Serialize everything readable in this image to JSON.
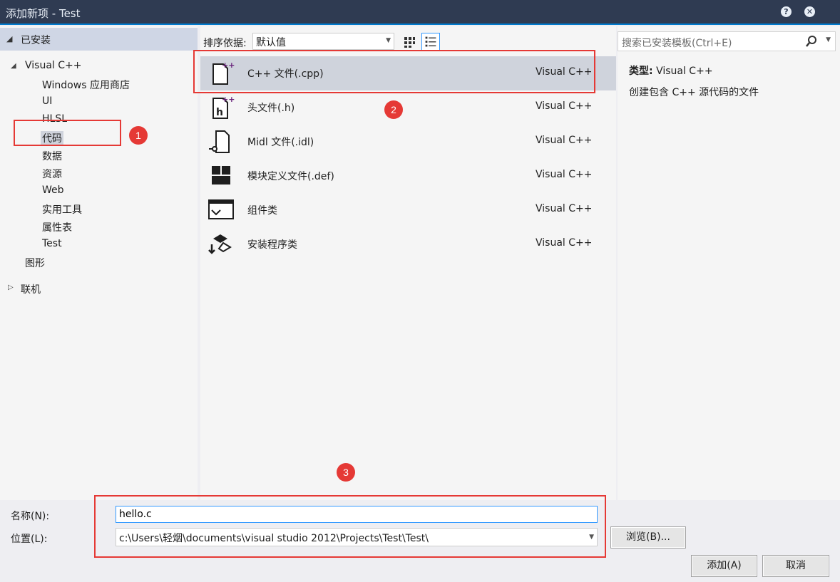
{
  "window": {
    "title": "添加新项 - Test"
  },
  "tree": {
    "installed": "已安装",
    "items": [
      {
        "label": "Visual C++"
      },
      {
        "label": "Windows 应用商店"
      },
      {
        "label": "UI"
      },
      {
        "label": "HLSL"
      },
      {
        "label": "代码"
      },
      {
        "label": "数据"
      },
      {
        "label": "资源"
      },
      {
        "label": "Web"
      },
      {
        "label": "实用工具"
      },
      {
        "label": "属性表"
      },
      {
        "label": "Test"
      },
      {
        "label": "图形"
      },
      {
        "label": "联机"
      }
    ]
  },
  "sort": {
    "label": "排序依据:",
    "value": "默认值"
  },
  "search": {
    "placeholder": "搜索已安装模板(Ctrl+E)"
  },
  "templates": [
    {
      "name": "C++ 文件(.cpp)",
      "lang": "Visual C++",
      "icon": "cpp-file-icon"
    },
    {
      "name": "头文件(.h)",
      "lang": "Visual C++",
      "icon": "header-file-icon"
    },
    {
      "name": "Midl 文件(.idl)",
      "lang": "Visual C++",
      "icon": "idl-file-icon"
    },
    {
      "name": "模块定义文件(.def)",
      "lang": "Visual C++",
      "icon": "def-file-icon"
    },
    {
      "name": "组件类",
      "lang": "Visual C++",
      "icon": "component-class-icon"
    },
    {
      "name": "安装程序类",
      "lang": "Visual C++",
      "icon": "installer-class-icon"
    }
  ],
  "details": {
    "type_label": "类型:",
    "type_value": "Visual C++",
    "description": "创建包含 C++ 源代码的文件"
  },
  "form": {
    "name_label": "名称(N):",
    "name_value": "hello.c",
    "location_label": "位置(L):",
    "location_value": "c:\\Users\\轻烟\\documents\\visual studio 2012\\Projects\\Test\\Test\\",
    "browse_label": "浏览(B)...",
    "add_label": "添加(A)",
    "cancel_label": "取消"
  },
  "annotations": [
    "1",
    "2",
    "3"
  ],
  "colors": {
    "titlebar": "#2f3b52",
    "accent": "#007acc",
    "annotation": "#e53935",
    "selection": "#cfd3dc"
  }
}
